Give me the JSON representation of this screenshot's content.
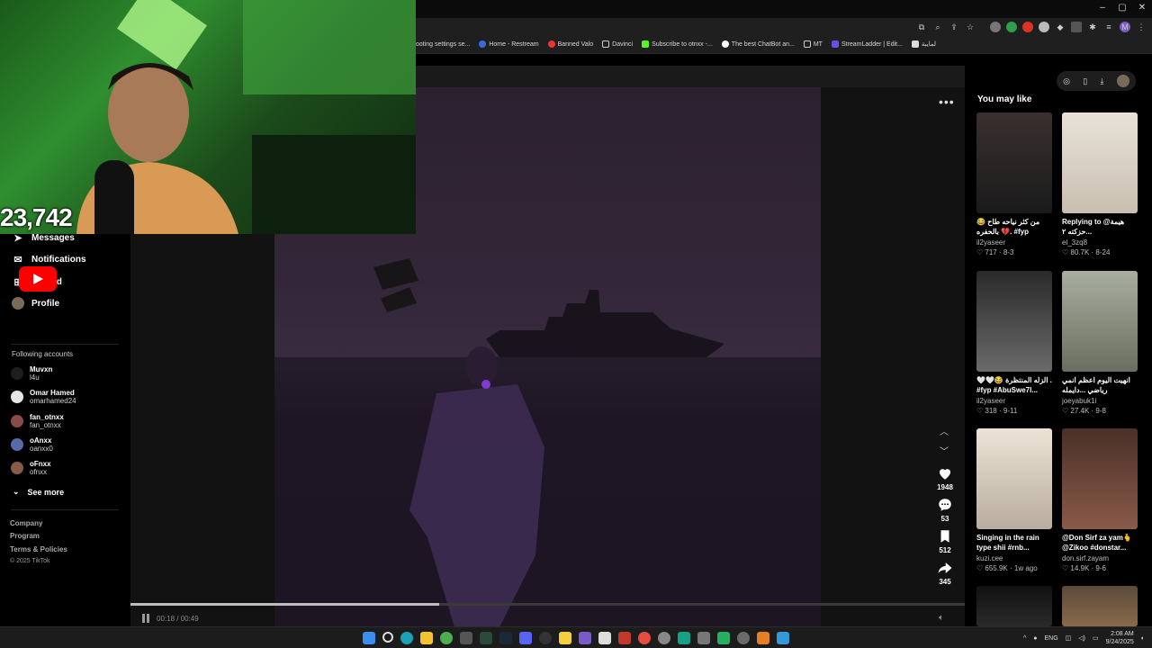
{
  "browser": {
    "window_controls": [
      "–",
      "▢",
      "✕"
    ],
    "bookmarks": [
      "ooting settings se...",
      "Home - Restream",
      "Banned Valo",
      "Davinci",
      "Subscribe to otnxx -...",
      "The best ChatBot an...",
      "MT",
      "StreamLadder | Edit...",
      "لمايبة"
    ]
  },
  "stream_overlay": {
    "viewer_count": "23,742"
  },
  "sidebar": {
    "items": [
      {
        "label": "Messages",
        "icon": "paper-plane-icon"
      },
      {
        "label": "Notifications",
        "icon": "inbox-icon"
      },
      {
        "label": "Upload",
        "icon": "upload-icon"
      },
      {
        "label": "Profile",
        "icon": "avatar"
      }
    ],
    "following_title": "Following accounts",
    "following": [
      {
        "name": "Muvxn",
        "handle": "l4u"
      },
      {
        "name": "Omar Hamed",
        "handle": "omarhamed24"
      },
      {
        "name": "fan_otnxx",
        "handle": "fan_otnxx"
      },
      {
        "name": "oAnxx",
        "handle": "oanxx0"
      },
      {
        "name": "oFnxx",
        "handle": "ofnxx"
      }
    ],
    "see_more": "See more",
    "footer_links": [
      "Company",
      "Program",
      "Terms & Policies"
    ],
    "copyright": "© 2025 TikTok"
  },
  "video": {
    "likes": "1948",
    "comments": "53",
    "saves": "512",
    "shares": "345",
    "time": "00:18 / 00:49",
    "progress_fraction": 0.37
  },
  "recommendations": {
    "title": "You may like",
    "cards": [
      {
        "caption": "😂 من كثر نياحه طاح بالحفره 💔. #fyp #abuswe7...",
        "user": "il2yaseer",
        "likes": "717",
        "date": "8-3",
        "color": "#2a2a2a"
      },
      {
        "caption": "Replying to @هيمة حزكته ٢...",
        "user": "el_3zq8",
        "likes": "80.7K",
        "date": "8-24",
        "color": "#cfc8bd"
      },
      {
        "caption": "🤍🤍😂 الزله المنتظرة . #fyp #AbuSwe7l...",
        "user": "il2yaseer",
        "likes": "318",
        "date": "9-11",
        "color": "#4a4a4a"
      },
      {
        "caption": "انهيت اليوم اعظم انمي رياضي ...دايمله #نمبر_البطل",
        "user": "joeyabuk1i",
        "likes": "27.4K",
        "date": "9-8",
        "color": "#8a8f7e"
      },
      {
        "caption": "Singing in the rain type shii #rnb...",
        "user": "kuzi.cee",
        "likes": "655.9K",
        "date": "1w ago",
        "color": "#d9cfc2"
      },
      {
        "caption": "@Don Sirf za yam🫰 @Zikoo #donstar...",
        "user": "don.sirf.zayam",
        "likes": "14.9K",
        "date": "9-6",
        "color": "#6a4a3a"
      }
    ]
  },
  "taskbar": {
    "language": "ENG",
    "time": "2:08 AM",
    "date": "9/24/2025"
  }
}
